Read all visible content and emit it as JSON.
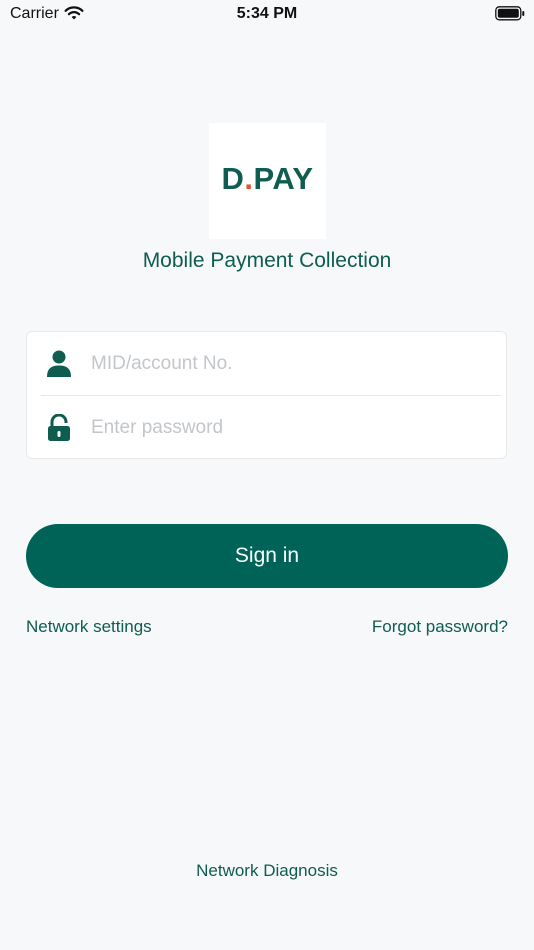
{
  "status_bar": {
    "carrier": "Carrier",
    "time": "5:34 PM"
  },
  "logo": {
    "left_text": "D",
    "dot": ".",
    "right_text": "PAY"
  },
  "subtitle": "Mobile Payment Collection",
  "login_form": {
    "account_placeholder": "MID/account No.",
    "password_placeholder": "Enter password",
    "account_icon": "user-icon",
    "password_icon": "lock-icon"
  },
  "actions": {
    "sign_in": "Sign in",
    "network_settings": "Network settings",
    "forgot_password": "Forgot password?",
    "network_diagnosis": "Network Diagnosis"
  },
  "colors": {
    "brand": "#006357",
    "accent_dot": "#e1542e",
    "background": "#f7f8fa",
    "placeholder": "#c3c6ca"
  }
}
